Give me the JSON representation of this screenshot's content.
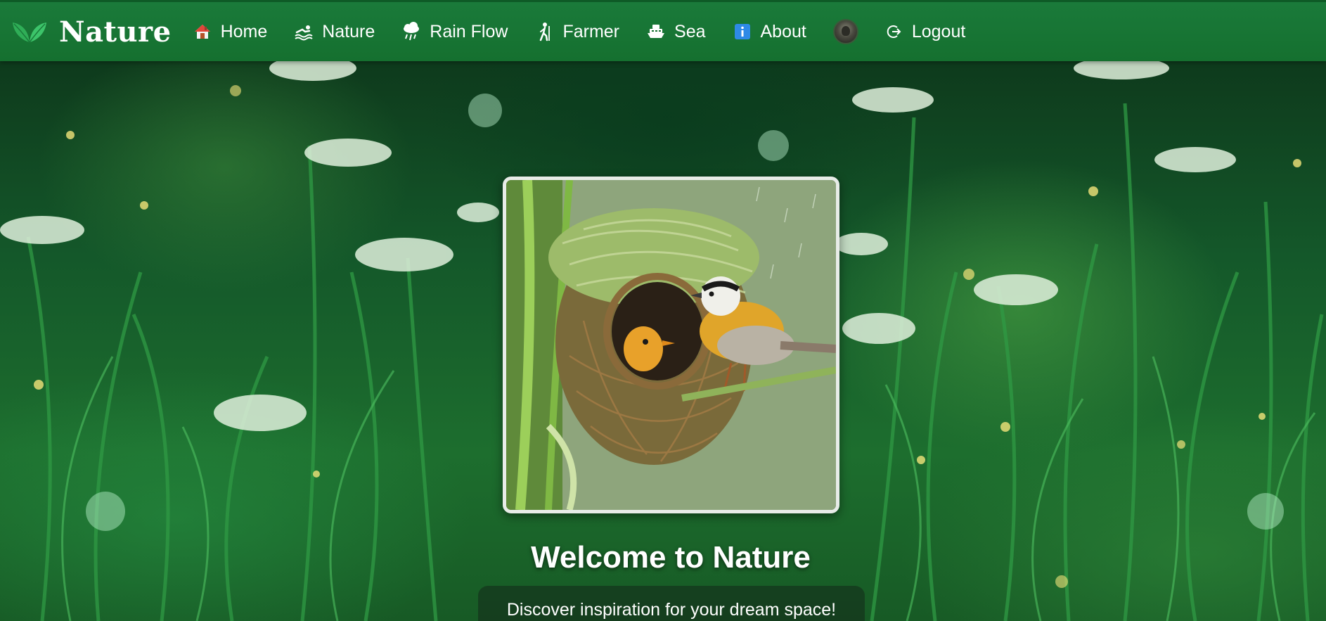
{
  "brand": {
    "name": "Nature",
    "logo_icon": "leaf-icon"
  },
  "nav": {
    "items": [
      {
        "label": "Home",
        "icon": "house-icon"
      },
      {
        "label": "Nature",
        "icon": "swimmer-icon"
      },
      {
        "label": "Rain Flow",
        "icon": "rain-cloud-icon"
      },
      {
        "label": "Farmer",
        "icon": "walking-person-icon"
      },
      {
        "label": "Sea",
        "icon": "ship-icon"
      },
      {
        "label": "About",
        "icon": "info-icon"
      }
    ],
    "avatar": "user-avatar",
    "logout": {
      "label": "Logout",
      "icon": "logout-icon"
    }
  },
  "hero": {
    "title": "Welcome to Nature",
    "tagline": "Discover inspiration for your dream space!"
  },
  "colors": {
    "navbar": "#1a7a3a",
    "accent_leaf": "#3cc46a",
    "text": "#ffffff",
    "frame_border": "#e8ece8"
  }
}
